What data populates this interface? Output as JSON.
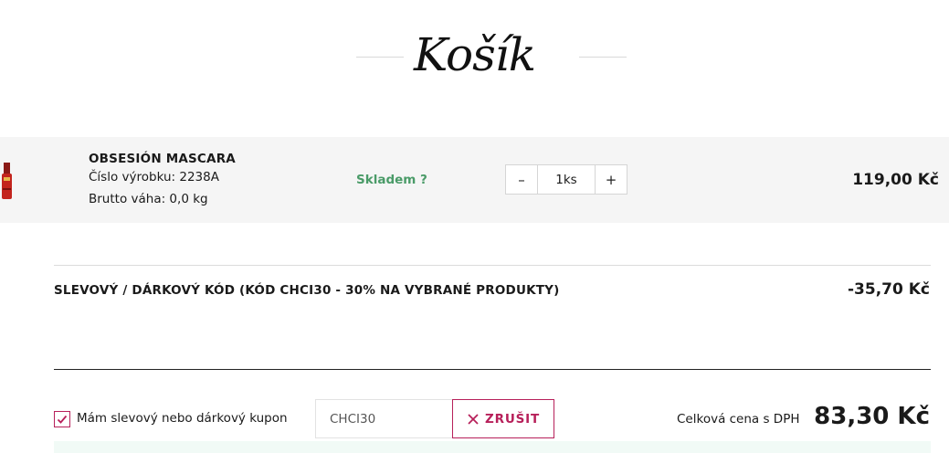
{
  "header": {
    "title": "Košík"
  },
  "cart": {
    "items": [
      {
        "name": "OBSESIÓN MASCARA",
        "code_line": "Číslo výrobku: 2238A",
        "weight_line": "Brutto váha: 0,0 kg",
        "stock": "Skladem ?",
        "quantity": "1ks",
        "minus_label": "–",
        "plus_label": "+",
        "price": "119,00 Kč",
        "image_icon": "mascara-product-icon"
      }
    ]
  },
  "discount": {
    "label": "SLEVOVÝ / DÁRKOVÝ KÓD (KÓD CHCI30 - 30% NA VYBRANÉ PRODUKTY)",
    "value": "-35,70 Kč"
  },
  "coupon": {
    "checkbox_label": "Mám slevový nebo dárkový kupon",
    "checked": true,
    "input_value": "CHCI30",
    "cancel_label": "ZRUŠIT"
  },
  "total": {
    "label": "Celková cena s DPH",
    "value": "83,30 Kč"
  },
  "colors": {
    "accent": "#b7205a",
    "stock_green": "#4a9b68",
    "row_bg": "#f5f5f5"
  }
}
